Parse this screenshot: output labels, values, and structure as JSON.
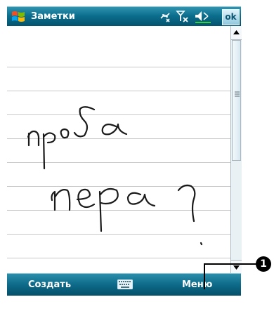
{
  "titlebar": {
    "app_title": "Заметки",
    "icons": [
      "windows-start-icon",
      "connectivity-icon",
      "signal-off-icon",
      "volume-icon"
    ],
    "ok_label": "ok"
  },
  "note": {
    "handwriting_line1": "проба",
    "handwriting_line2": "пера?"
  },
  "cmdbar": {
    "left_label": "Создать",
    "center_icon": "keyboard-icon",
    "right_label": "Меню"
  },
  "callout": {
    "number": "1"
  },
  "colors": {
    "bar_dark": "#044f6a",
    "bar_light": "#2f94b0",
    "rule_line": "#c6c8cc"
  }
}
